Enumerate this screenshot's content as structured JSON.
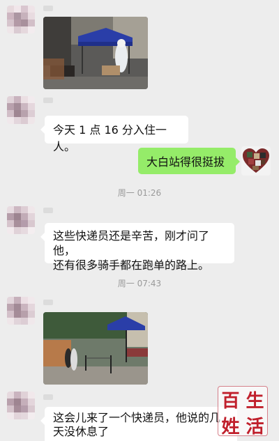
{
  "messages": {
    "msg2": "今天 1 点 16 分入住一人。",
    "msg3": "大白站得很挺拔",
    "time1": "周一 01:26",
    "msg4_line1": "这些快递员还是辛苦，刚才问了他，",
    "msg4_line2": "还有很多骑手都在跑单的路上。",
    "time2": "周一 07:43",
    "msg6_line1": "这会儿来了一个快递员，他说的几",
    "msg6_line2": "天没休息了"
  },
  "watermark": {
    "c1": "百",
    "c2": "生",
    "c3": "姓",
    "c4": "活"
  },
  "colors": {
    "background": "#ededed",
    "bubble_incoming": "#ffffff",
    "bubble_outgoing": "#95ec69",
    "watermark_red": "#c0202c"
  }
}
